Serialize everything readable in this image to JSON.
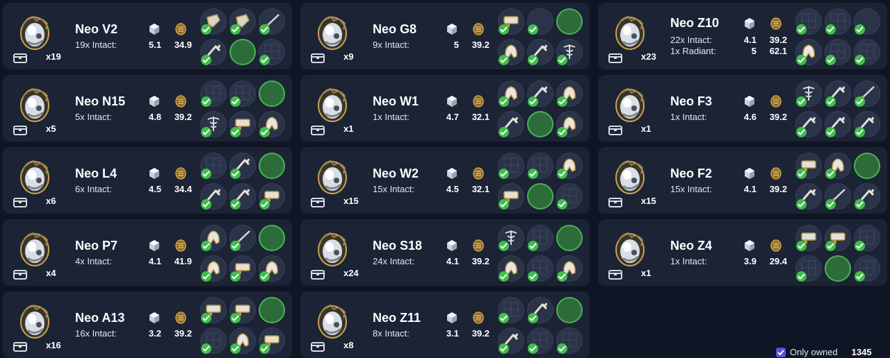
{
  "relics": [
    {
      "name": "Neo V2",
      "count": "x19",
      "refinements": [
        "19x Intact:"
      ],
      "ducats": [
        "5.1"
      ],
      "values": [
        "34.9"
      ],
      "parts": [
        {
          "icon": "prime-part-icon",
          "owned": true
        },
        {
          "icon": "prime-part-icon",
          "owned": true
        },
        {
          "icon": "blade-part-icon",
          "owned": true
        },
        {
          "icon": "barrel-part-icon",
          "owned": true
        },
        {
          "icon": "forma-blueprint-icon",
          "owned": false
        },
        {
          "icon": "blueprint-icon",
          "owned": true
        }
      ]
    },
    {
      "name": "Neo G8",
      "count": "x9",
      "refinements": [
        "9x Intact:"
      ],
      "ducats": [
        "5"
      ],
      "values": [
        "39.2"
      ],
      "parts": [
        {
          "icon": "receiver-part-icon",
          "owned": true
        },
        {
          "icon": "forma-blueprint-icon",
          "owned": true
        },
        {
          "icon": "forma-blueprint-icon",
          "owned": false
        },
        {
          "icon": "helmet-part-icon",
          "owned": true
        },
        {
          "icon": "barrel-part-icon",
          "owned": true
        },
        {
          "icon": "caduceus-part-icon",
          "owned": true
        }
      ]
    },
    {
      "name": "Neo Z10",
      "count": "x23",
      "refinements": [
        "22x Intact:",
        "1x Radiant:"
      ],
      "ducats": [
        "4.1",
        "5"
      ],
      "values": [
        "39.2",
        "62.1"
      ],
      "parts": [
        {
          "icon": "blueprint-icon",
          "owned": true
        },
        {
          "icon": "blueprint-icon",
          "owned": true
        },
        {
          "icon": "forma-blueprint-icon",
          "owned": true
        },
        {
          "icon": "helmet-part-icon",
          "owned": true
        },
        {
          "icon": "blueprint-icon",
          "owned": true
        },
        {
          "icon": "blueprint-icon",
          "owned": true
        }
      ]
    },
    {
      "name": "Neo N15",
      "count": "x5",
      "refinements": [
        "5x Intact:"
      ],
      "ducats": [
        "4.8"
      ],
      "values": [
        "39.2"
      ],
      "parts": [
        {
          "icon": "blueprint-icon",
          "owned": true
        },
        {
          "icon": "blueprint-icon",
          "owned": true
        },
        {
          "icon": "forma-blueprint-icon",
          "owned": false
        },
        {
          "icon": "caduceus-part-icon",
          "owned": true
        },
        {
          "icon": "receiver-part-icon",
          "owned": true
        },
        {
          "icon": "helmet-part-icon",
          "owned": true
        }
      ]
    },
    {
      "name": "Neo W1",
      "count": "x1",
      "refinements": [
        "1x Intact:"
      ],
      "ducats": [
        "4.7"
      ],
      "values": [
        "32.1"
      ],
      "parts": [
        {
          "icon": "helmet-part-icon",
          "owned": true
        },
        {
          "icon": "barrel-part-icon",
          "owned": true
        },
        {
          "icon": "helmet-part-icon",
          "owned": true
        },
        {
          "icon": "barrel-part-icon",
          "owned": true
        },
        {
          "icon": "forma-blueprint-icon",
          "owned": false
        },
        {
          "icon": "helmet-part-icon",
          "owned": true
        }
      ]
    },
    {
      "name": "Neo F3",
      "count": "x1",
      "refinements": [
        "1x Intact:"
      ],
      "ducats": [
        "4.6"
      ],
      "values": [
        "39.2"
      ],
      "parts": [
        {
          "icon": "caduceus-part-icon",
          "owned": true
        },
        {
          "icon": "barrel-part-icon",
          "owned": true
        },
        {
          "icon": "blade-part-icon",
          "owned": true
        },
        {
          "icon": "barrel-part-icon",
          "owned": true
        },
        {
          "icon": "barrel-part-icon",
          "owned": true
        },
        {
          "icon": "barrel-part-icon",
          "owned": true
        }
      ]
    },
    {
      "name": "Neo L4",
      "count": "x6",
      "refinements": [
        "6x Intact:"
      ],
      "ducats": [
        "4.5"
      ],
      "values": [
        "34.4"
      ],
      "parts": [
        {
          "icon": "blueprint-icon",
          "owned": true
        },
        {
          "icon": "barrel-part-icon",
          "owned": true
        },
        {
          "icon": "forma-blueprint-icon",
          "owned": false
        },
        {
          "icon": "barrel-part-icon",
          "owned": true
        },
        {
          "icon": "barrel-part-icon",
          "owned": true
        },
        {
          "icon": "receiver-part-icon",
          "owned": true
        }
      ]
    },
    {
      "name": "Neo W2",
      "count": "x15",
      "refinements": [
        "15x Intact:"
      ],
      "ducats": [
        "4.5"
      ],
      "values": [
        "32.1"
      ],
      "parts": [
        {
          "icon": "blueprint-icon",
          "owned": true
        },
        {
          "icon": "blueprint-icon",
          "owned": true
        },
        {
          "icon": "helmet-part-icon",
          "owned": true
        },
        {
          "icon": "receiver-part-icon",
          "owned": true
        },
        {
          "icon": "forma-blueprint-icon",
          "owned": false
        },
        {
          "icon": "blueprint-icon",
          "owned": true
        }
      ]
    },
    {
      "name": "Neo F2",
      "count": "x15",
      "refinements": [
        "15x Intact:"
      ],
      "ducats": [
        "4.1"
      ],
      "values": [
        "39.2"
      ],
      "parts": [
        {
          "icon": "receiver-part-icon",
          "owned": true
        },
        {
          "icon": "helmet-part-icon",
          "owned": true
        },
        {
          "icon": "forma-blueprint-icon",
          "owned": false
        },
        {
          "icon": "barrel-part-icon",
          "owned": true
        },
        {
          "icon": "blade-part-icon",
          "owned": true
        },
        {
          "icon": "barrel-part-icon",
          "owned": true
        }
      ]
    },
    {
      "name": "Neo P7",
      "count": "x4",
      "refinements": [
        "4x Intact:"
      ],
      "ducats": [
        "4.1"
      ],
      "values": [
        "41.9"
      ],
      "parts": [
        {
          "icon": "helmet-part-icon",
          "owned": true
        },
        {
          "icon": "blade-part-icon",
          "owned": true
        },
        {
          "icon": "forma-blueprint-icon",
          "owned": false
        },
        {
          "icon": "helmet-part-icon",
          "owned": true
        },
        {
          "icon": "receiver-part-icon",
          "owned": true
        },
        {
          "icon": "helmet-part-icon",
          "owned": true
        }
      ]
    },
    {
      "name": "Neo S18",
      "count": "x24",
      "refinements": [
        "24x Intact:"
      ],
      "ducats": [
        "4.1"
      ],
      "values": [
        "39.2"
      ],
      "parts": [
        {
          "icon": "caduceus-part-icon",
          "owned": true
        },
        {
          "icon": "blueprint-icon",
          "owned": true
        },
        {
          "icon": "forma-blueprint-icon",
          "owned": false
        },
        {
          "icon": "helmet-part-icon",
          "owned": true
        },
        {
          "icon": "blueprint-icon",
          "owned": true
        },
        {
          "icon": "helmet-part-icon",
          "owned": true
        }
      ]
    },
    {
      "name": "Neo Z4",
      "count": "x1",
      "refinements": [
        "1x Intact:"
      ],
      "ducats": [
        "3.9"
      ],
      "values": [
        "29.4"
      ],
      "parts": [
        {
          "icon": "receiver-part-icon",
          "owned": true
        },
        {
          "icon": "receiver-part-icon",
          "owned": true
        },
        {
          "icon": "blueprint-icon",
          "owned": true
        },
        {
          "icon": "blueprint-icon",
          "owned": true
        },
        {
          "icon": "forma-blueprint-icon",
          "owned": false
        },
        {
          "icon": "blueprint-icon",
          "owned": true
        }
      ]
    },
    {
      "name": "Neo A13",
      "count": "x16",
      "refinements": [
        "16x Intact:"
      ],
      "ducats": [
        "3.2"
      ],
      "values": [
        "39.2"
      ],
      "parts": [
        {
          "icon": "receiver-part-icon",
          "owned": true
        },
        {
          "icon": "receiver-part-icon",
          "owned": true
        },
        {
          "icon": "forma-blueprint-icon",
          "owned": false
        },
        {
          "icon": "blueprint-icon",
          "owned": true
        },
        {
          "icon": "helmet-part-icon",
          "owned": true
        },
        {
          "icon": "receiver-part-icon",
          "owned": true
        }
      ]
    },
    {
      "name": "Neo Z11",
      "count": "x8",
      "refinements": [
        "8x Intact:"
      ],
      "ducats": [
        "3.1"
      ],
      "values": [
        "39.2"
      ],
      "parts": [
        {
          "icon": "blueprint-icon",
          "owned": true
        },
        {
          "icon": "barrel-part-icon",
          "owned": true
        },
        {
          "icon": "forma-blueprint-icon",
          "owned": false
        },
        {
          "icon": "barrel-part-icon",
          "owned": true
        },
        {
          "icon": "blueprint-icon",
          "owned": true
        },
        {
          "icon": "blueprint-icon",
          "owned": true
        }
      ]
    }
  ],
  "footer": {
    "checkbox_label": "Only owned",
    "checked": true,
    "total": "1345"
  },
  "colors": {
    "background": "#0f1524",
    "card": "#1b2335",
    "check_green": "#3fbf4a",
    "empty_slot": "#2e6b3a",
    "checkbox": "#5a4fe0"
  }
}
